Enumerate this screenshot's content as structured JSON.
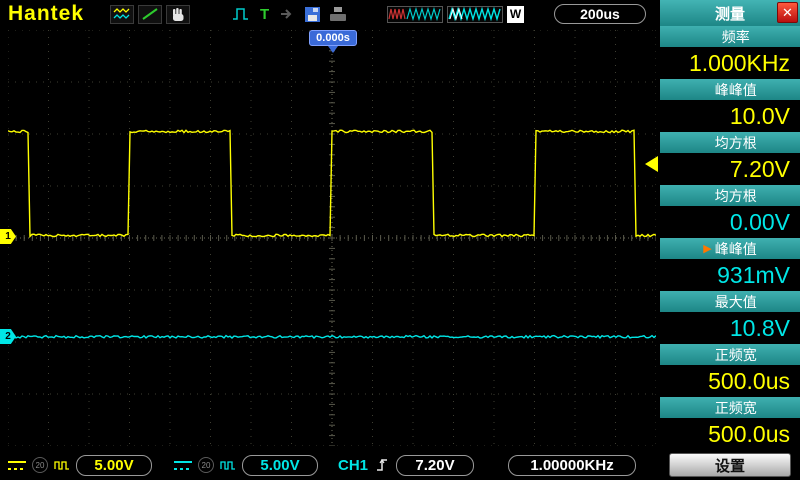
{
  "brand": "Hantek",
  "colors": {
    "ch1": "#ffff00",
    "ch2": "#00e6e6",
    "panel_header": "#2a9d9d",
    "accent_blue": "#3a6ad8",
    "close_red": "#cc1111",
    "selected_arrow": "#ff7700"
  },
  "top_bar": {
    "timebase": "200us",
    "w_label": "W"
  },
  "scope": {
    "time_offset": "0.000s",
    "ch1_tag": "1",
    "ch2_tag": "2"
  },
  "measure_panel": {
    "title": "测量",
    "settings_label": "设置",
    "items": [
      {
        "label": "频率",
        "value": "1.000KHz",
        "color": "#ffff00",
        "selected": false
      },
      {
        "label": "峰峰值",
        "value": "10.0V",
        "color": "#ffff00",
        "selected": false
      },
      {
        "label": "均方根",
        "value": "7.20V",
        "color": "#ffff00",
        "selected": false
      },
      {
        "label": "均方根",
        "value": "0.00V",
        "color": "#00e6e6",
        "selected": false
      },
      {
        "label": "峰峰值",
        "value": "931mV",
        "color": "#00e6e6",
        "selected": true
      },
      {
        "label": "最大值",
        "value": "10.8V",
        "color": "#00e6e6",
        "selected": false
      },
      {
        "label": "正频宽",
        "value": "500.0us",
        "color": "#ffff00",
        "selected": false
      },
      {
        "label": "正频宽",
        "value": "500.0us",
        "color": "#ffff00",
        "selected": false
      }
    ]
  },
  "bottom_bar": {
    "ch1": {
      "bw": "20",
      "scale": "5.00V"
    },
    "ch2": {
      "bw": "20",
      "scale": "5.00V"
    },
    "trigger": {
      "source": "CH1",
      "level": "7.20V"
    },
    "freq_counter": "1.00000KHz"
  },
  "chart_data": {
    "type": "line",
    "title": "Oscilloscope traces",
    "grid_divisions": {
      "x": 16,
      "y": 8
    },
    "timebase_per_div": "200us",
    "x_range_us": [
      -1600,
      1600
    ],
    "series": [
      {
        "name": "CH1",
        "color": "#ffff00",
        "shape": "square",
        "volts_per_div": 5.0,
        "frequency_hz": 1000,
        "vpp_volts": 10.0,
        "high_volts": 10.0,
        "low_volts": 0.0,
        "period_div": 5,
        "duty": 0.5,
        "rising_edge_div": 8,
        "high_level_div": 1.95,
        "low_level_div": 3.95
      },
      {
        "name": "CH2",
        "color": "#00e6e6",
        "shape": "flat",
        "volts_per_div": 5.0,
        "level_volts": 0.0,
        "level_div": 5.9
      }
    ],
    "trigger": {
      "source": "CH1",
      "level_volts": 7.2,
      "level_div": 2.55,
      "position_div": 8
    }
  }
}
